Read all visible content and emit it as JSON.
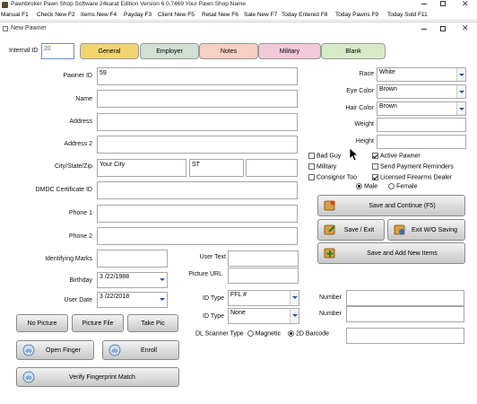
{
  "app": {
    "title": "Pawnbroker Pawn Shop Software 24karat Edition Version 6.0.7469 Your Pawn Shop Name",
    "menu": [
      "Manual F1",
      "Check New F2",
      "Items New F4",
      "Payday F3",
      "Client New F5",
      "Retail New F6",
      "Sale New F7",
      "Today Entered F8",
      "Today Pawns F9",
      "Today Sold F11"
    ]
  },
  "dialog": {
    "title": "New Pawner",
    "internal_id_label": "Internal ID",
    "internal_id": "20",
    "tabs": [
      "General",
      "Employer",
      "Notes",
      "Military",
      "Blank"
    ],
    "tab_colors": [
      "#f0d470",
      "#cfe0d4",
      "#f6d0c2",
      "#f2c9d9",
      "#d6ecc6"
    ]
  },
  "form": {
    "pawner_id_label": "Pawner ID",
    "pawner_id": "59",
    "name_label": "Name",
    "address_label": "Address",
    "address2_label": "Address 2",
    "city_label": "City/State/Zip",
    "city": "Your City",
    "state": "ST",
    "dmdc_label": "DMDC Certificate ID",
    "phone1_label": "Phone 1",
    "phone2_label": "Phone 2",
    "marks_label": "Identifying Marks",
    "birthday_label": "Birthday",
    "birthday": "3 /22/1988",
    "user_date_label": "User Date",
    "user_date": "3 /22/2018",
    "user_text_label": "User Text",
    "picture_url_label": "Picture URL",
    "id_type_label": "ID Type",
    "id_type1": "FFL #",
    "id_type2": "None",
    "number_label": "Number",
    "dl_scanner_label": "DL Scanner Type",
    "magnetic_label": "Magnetic",
    "barcode_label": "2D Barcode"
  },
  "right": {
    "race_label": "Race",
    "race": "White",
    "eye_label": "Eye Color",
    "eye": "Brown",
    "hair_label": "Hair Color",
    "hair": "Brown",
    "weight_label": "Weight",
    "height_label": "Height"
  },
  "checks": {
    "bad_guy": "Bad Guy",
    "military": "Military",
    "consignor": "Consignor Too",
    "active": "Active Pawner",
    "send_reminders": "Send Payment Reminders",
    "licensed": "Licensed Firearms Dealer",
    "male": "Male",
    "female": "Female"
  },
  "buttons": {
    "save_continue": "Save and Continue (F5)",
    "save_exit": "Save / Exit",
    "exit_wo": "Exit W/O Saving",
    "save_add": "Save and  Add New Items",
    "no_picture": "No Picture",
    "picture_file": "Picture File",
    "take_pic": "Take Pic",
    "open_finger": "Open Finger",
    "enroll": "Enroll",
    "verify": "Verify Fingerprint Match"
  }
}
